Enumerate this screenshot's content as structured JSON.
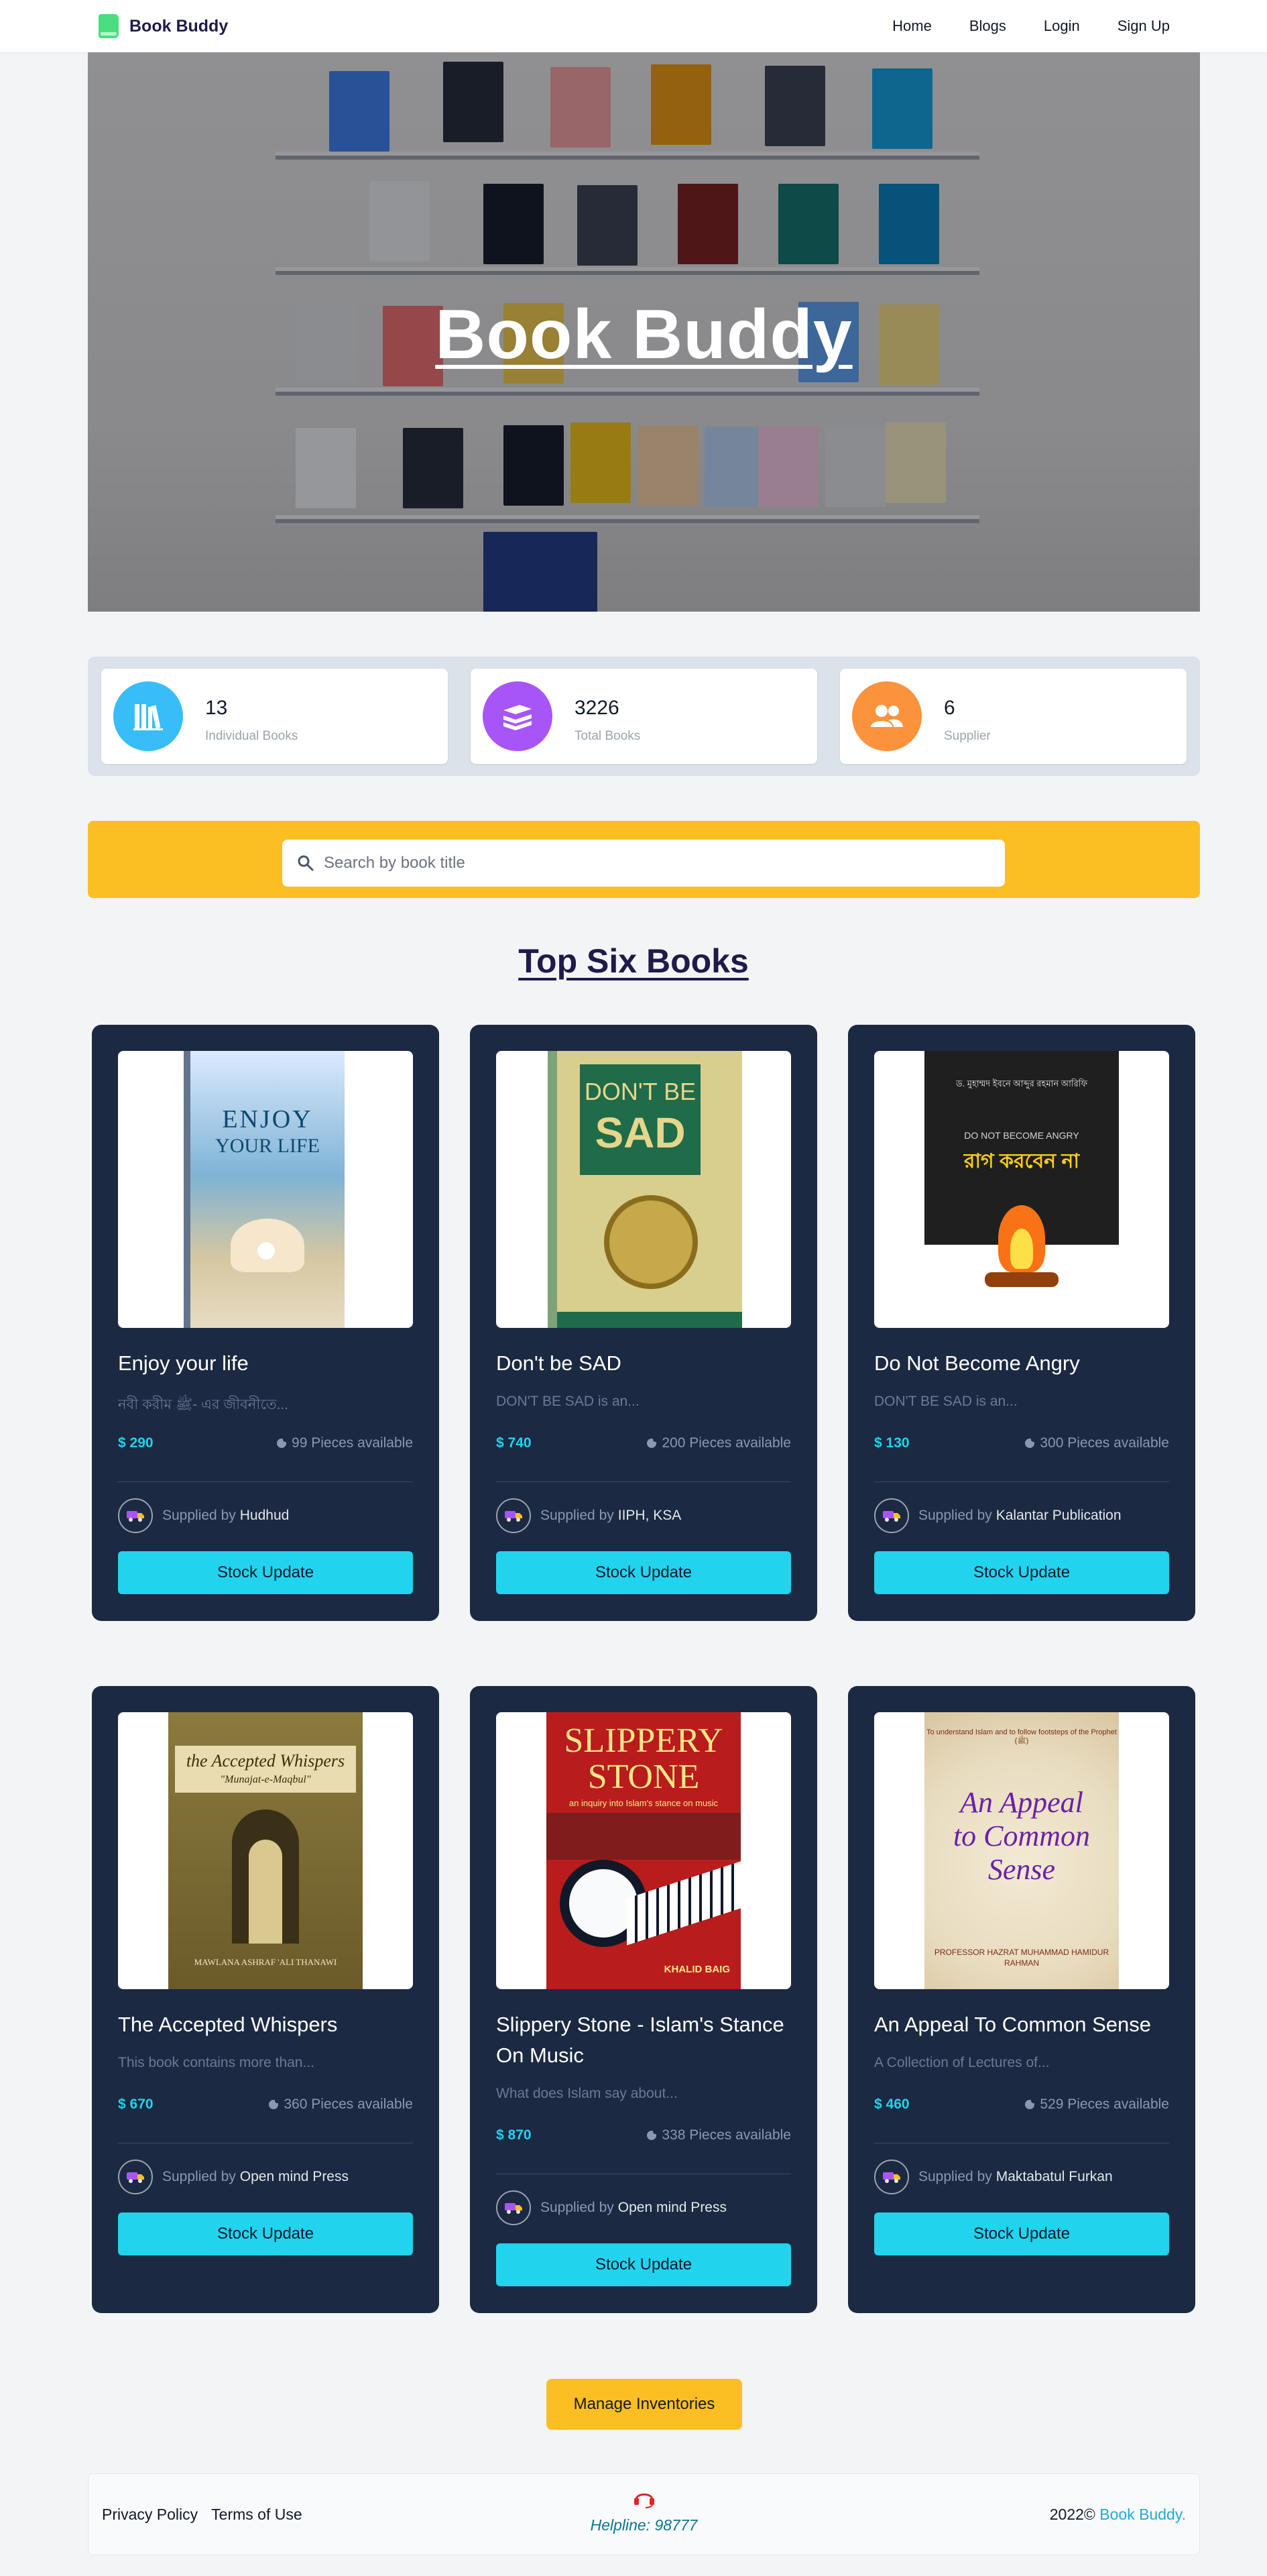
{
  "brand": {
    "name": "Book Buddy",
    "icon": "book-icon"
  },
  "nav": {
    "links": [
      "Home",
      "Blogs",
      "Login",
      "Sign Up"
    ]
  },
  "hero": {
    "title": "Book Buddy"
  },
  "stats": [
    {
      "value": "13",
      "label": "Individual Books",
      "icon": "books-icon",
      "color": "#38bdf8"
    },
    {
      "value": "3226",
      "label": "Total Books",
      "icon": "layers-icon",
      "color": "#a855f7"
    },
    {
      "value": "6",
      "label": "Supplier",
      "icon": "users-icon",
      "color": "#fb923c"
    }
  ],
  "search": {
    "placeholder": "Search by book title",
    "value": ""
  },
  "section_title": "Top Six Books",
  "books": [
    {
      "title": "Enjoy your life",
      "description": "নবী করীম ﷺ- এর জীবনীতে...",
      "price": "$ 290",
      "stock": "99 Pieces available",
      "supplied_by": "Supplied by",
      "supplier": "Hudhud",
      "button": "Stock Update"
    },
    {
      "title": "Don't be SAD",
      "description": "DON'T BE SAD is an...",
      "price": "$ 740",
      "stock": "200 Pieces available",
      "supplied_by": "Supplied by",
      "supplier": "IIPH, KSA",
      "button": "Stock Update"
    },
    {
      "title": "Do Not Become Angry",
      "description": "DON'T BE SAD is an...",
      "price": "$ 130",
      "stock": "300 Pieces available",
      "supplied_by": "Supplied by",
      "supplier": "Kalantar Publication",
      "button": "Stock Update"
    },
    {
      "title": "The Accepted Whispers",
      "description": "This book contains more than...",
      "price": "$ 670",
      "stock": "360 Pieces available",
      "supplied_by": "Supplied by",
      "supplier": "Open mind Press",
      "button": "Stock Update"
    },
    {
      "title": "Slippery Stone - Islam's Stance On Music",
      "description": "What does Islam say about...",
      "price": "$ 870",
      "stock": "338 Pieces available",
      "supplied_by": "Supplied by",
      "supplier": "Open mind Press",
      "button": "Stock Update"
    },
    {
      "title": "An Appeal To Common Sense",
      "description": "A Collection of Lectures of...",
      "price": "$ 460",
      "stock": "529 Pieces available",
      "supplied_by": "Supplied by",
      "supplier": "Maktabatul Furkan",
      "button": "Stock Update"
    }
  ],
  "covers": [
    {
      "lines": [
        "ENJOY",
        "YOUR LIFE"
      ],
      "bg": "#7fb3d5"
    },
    {
      "lines": [
        "DON'T BE",
        "SAD"
      ],
      "bg": "#d8cf8e"
    },
    {
      "lines": [
        "ড. মুহাম্মদ ইবনে আব্দুর রহমান আরিফি",
        "DO NOT BECOME ANGRY",
        "রাগ করবেন না"
      ],
      "bg": "#1f1f1f"
    },
    {
      "lines": [
        "the Accepted Whispers",
        "\"Munajat-e-Maqbul\"",
        "MAWLANA ASHRAF 'ALI THANAWI"
      ],
      "bg": "#6b5b2a"
    },
    {
      "lines": [
        "SLIPPERY",
        "STONE",
        "an inquiry into Islam's stance on music",
        "KHALID BAIG"
      ],
      "bg": "#b91c1c"
    },
    {
      "lines": [
        "An Appeal to Common Sense",
        "PROFESSOR HAZRAT MUHAMMAD HAMIDUR RAHMAN"
      ],
      "bg": "#e8dcc0"
    }
  ],
  "manage_button": "Manage Inventories",
  "footer": {
    "links": [
      "Privacy Policy",
      "Terms of Use"
    ],
    "helpline": "Helpline: 98777",
    "helpline_icon": "headset-icon",
    "copyright": "2022©",
    "copyright_brand": "Book Buddy."
  },
  "colors": {
    "accent": "#22d3ee",
    "card_bg": "#1b2942",
    "highlight": "#fbbf24",
    "navy": "#1e1b4b"
  }
}
